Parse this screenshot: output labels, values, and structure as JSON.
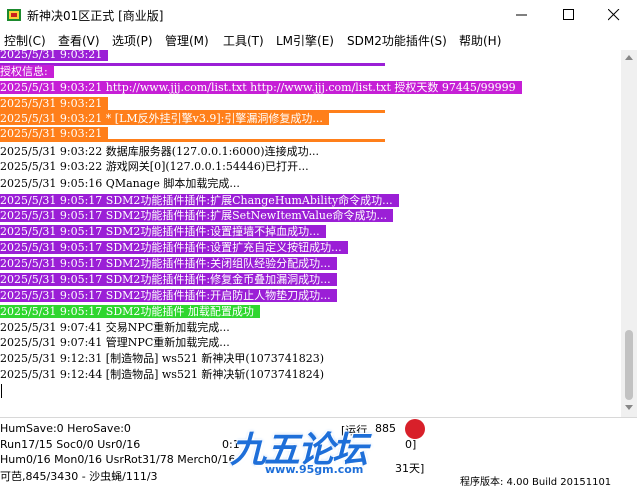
{
  "window": {
    "title": "新神决01区正式 [商业版]"
  },
  "menu": [
    {
      "label": "控制(C)"
    },
    {
      "label": "查看(V)"
    },
    {
      "label": "选项(P)"
    },
    {
      "label": "管理(M)"
    },
    {
      "label": "工具(T)"
    },
    {
      "label": "LM引擎(E)"
    },
    {
      "label": "SDM2功能插件(S)"
    },
    {
      "label": "帮助(H)"
    }
  ],
  "log": [
    {
      "text": "2025/5/31 9:03:21",
      "bg": "#9b1fd6",
      "fg": "#ffffff",
      "bar_after": "#9b1fd6"
    },
    {
      "text": "授权信息:",
      "bg": "#c61fd6",
      "fg": "#ffffff"
    },
    {
      "text": "2025/5/31 9:03:21 http://www.jjj.com/list.txt http://www.jjj.com/list.txt 授权天数 97445/99999",
      "bg": "#c61fd6",
      "fg": "#ffffff"
    },
    {
      "text": "2025/5/31 9:03:21",
      "bg": "#ff7f1a",
      "fg": "#ffffff",
      "bar_after": "#ff7f1a"
    },
    {
      "text": "2025/5/31 9:03:21 * [LM反外挂引擎v3.9]:引擎漏洞修复成功...",
      "bg": "#ff7f1a",
      "fg": "#ffffff"
    },
    {
      "text": "2025/5/31 9:03:21",
      "bg": "#ff7f1a",
      "fg": "#ffffff",
      "bar_after": "#ff7f1a"
    },
    {
      "text": "2025/5/31 9:03:22 数据库服务器(127.0.0.1:6000)连接成功...",
      "bg": "",
      "fg": "#000000"
    },
    {
      "text": "2025/5/31 9:03:22 游戏网关[0](127.0.0.1:54446)已打开...",
      "bg": "",
      "fg": "#000000"
    },
    {
      "text": "2025/5/31 9:05:16 QManage 脚本加载完成...",
      "bg": "",
      "fg": "#000000"
    },
    {
      "text": "2025/5/31 9:05:17 SDM2功能插件插件:扩展ChangeHumAbility命令成功...",
      "bg": "#9b1fd6",
      "fg": "#ffffff"
    },
    {
      "text": "2025/5/31 9:05:17 SDM2功能插件插件:扩展SetNewItemValue命令成功...",
      "bg": "#9b1fd6",
      "fg": "#ffffff"
    },
    {
      "text": "2025/5/31 9:05:17 SDM2功能插件插件:设置撞墙不掉血成功...",
      "bg": "#9b1fd6",
      "fg": "#ffffff"
    },
    {
      "text": "2025/5/31 9:05:17 SDM2功能插件插件:设置扩充自定义按钮成功...",
      "bg": "#9b1fd6",
      "fg": "#ffffff"
    },
    {
      "text": "2025/5/31 9:05:17 SDM2功能插件插件:关闭组队经验分配成功...",
      "bg": "#9b1fd6",
      "fg": "#ffffff"
    },
    {
      "text": "2025/5/31 9:05:17 SDM2功能插件插件:修复金币叠加漏洞成功...",
      "bg": "#9b1fd6",
      "fg": "#ffffff"
    },
    {
      "text": "2025/5/31 9:05:17 SDM2功能插件插件:开启防止人物垫刀成功...",
      "bg": "#9b1fd6",
      "fg": "#ffffff"
    },
    {
      "text": "2025/5/31 9:05:17 SDM2功能插件 加载配置成功",
      "bg": "#2fd62f",
      "fg": "#ffffff"
    },
    {
      "text": "2025/5/31 9:07:41 交易NPC重新加载完成...",
      "bg": "",
      "fg": "#000000"
    },
    {
      "text": "2025/5/31 9:07:41 管理NPC重新加载完成...",
      "bg": "",
      "fg": "#000000"
    },
    {
      "text": "2025/5/31 9:12:31 [制造物品] ws521 新神决甲(1073741823)",
      "bg": "",
      "fg": "#000000"
    },
    {
      "text": "2025/5/31 9:12:44 [制造物品] ws521 新神决斩(1073741824)",
      "bg": "",
      "fg": "#000000"
    }
  ],
  "status": {
    "line1": "HumSave:0 HeroSave:0",
    "line2": "Run17/15 Soc0/0 Usr0/16",
    "line3": "Hum0/16 Mon0/16 UsrRot31/78 Merch0/16",
    "line4": "可芭,845/3430 - 沙虫蝇/111/3",
    "mid1": "0:1",
    "right1": "[运行",
    "right1b": "885",
    "right2": "0]",
    "right3": "31天]",
    "version": "程序版本: 4.00 Build 20151101"
  },
  "watermark": {
    "text": "九五论坛",
    "url": "www.95gm.com"
  },
  "colors": {
    "purple": "#9b1fd6",
    "magenta": "#c61fd6",
    "orange": "#ff7f1a",
    "green": "#2fd62f"
  }
}
